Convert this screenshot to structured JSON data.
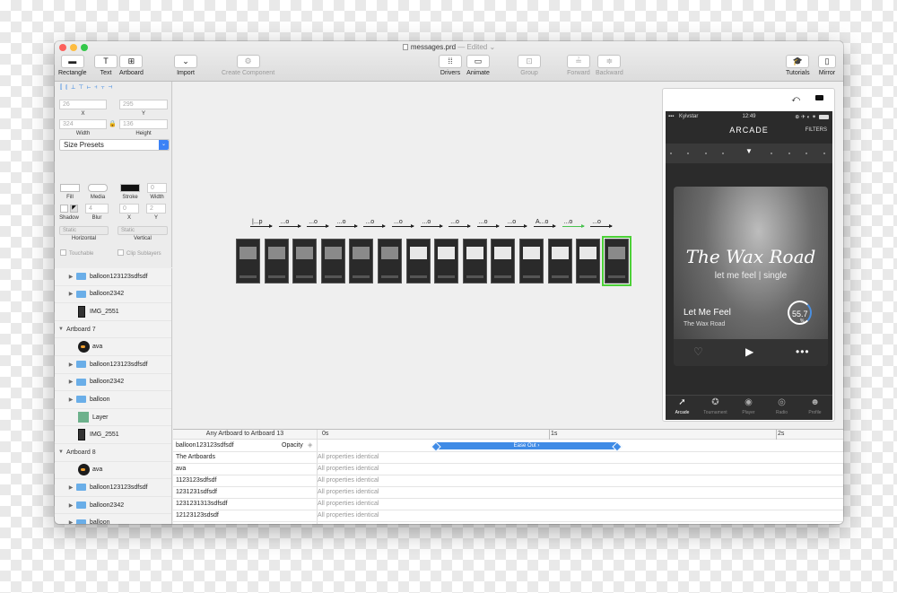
{
  "window": {
    "title": "messages.prd",
    "title_status": "— Edited ⌄",
    "traffic_colors": [
      "#fc605c",
      "#fdbc40",
      "#34c84a"
    ]
  },
  "toolbar": {
    "rectangle": "Rectangle",
    "text": "Text",
    "artboard": "Artboard",
    "import": "Import",
    "create_component": "Create Component",
    "drivers": "Drivers",
    "animate": "Animate",
    "group": "Group",
    "forward": "Forward",
    "backward": "Backward",
    "tutorials": "Tutorials",
    "mirror": "Mirror"
  },
  "inspector": {
    "x_value": "26",
    "y_value": "295",
    "x_label": "X",
    "y_label": "Y",
    "width_value": "324",
    "height_value": "136",
    "width_label": "Width",
    "height_label": "Height",
    "size_presets": "Size Presets",
    "fill_label": "Fill",
    "media_label": "Media",
    "stroke_label": "Stroke",
    "stroke_width_value": "0",
    "stroke_width_label": "Width",
    "shadow_label": "Shadow",
    "blur_value": "4",
    "blur_label": "Blur",
    "sx_value": "0",
    "sy_value": "2",
    "sx_label": "X",
    "sy_label": "Y",
    "horizontal_value": "Static",
    "vertical_value": "Static",
    "horizontal_label": "Horizontal",
    "vertical_label": "Vertical",
    "touchable": "Touchable",
    "clip_sublayers": "Clip Sublayers"
  },
  "layers": [
    {
      "type": "folder",
      "label": "balloon123123sdfsdf",
      "indent": 1
    },
    {
      "type": "folder",
      "label": "balloon2342",
      "indent": 1
    },
    {
      "type": "image",
      "label": "IMG_2551",
      "indent": 1
    },
    {
      "type": "header",
      "label": "Artboard 7"
    },
    {
      "type": "avatar",
      "label": "ava",
      "indent": 1
    },
    {
      "type": "folder",
      "label": "balloon123123sdfsdf",
      "indent": 1
    },
    {
      "type": "folder",
      "label": "balloon2342",
      "indent": 1
    },
    {
      "type": "folder",
      "label": "balloon",
      "indent": 1
    },
    {
      "type": "layer",
      "label": "Layer",
      "indent": 1
    },
    {
      "type": "image",
      "label": "IMG_2551",
      "indent": 1
    },
    {
      "type": "header",
      "label": "Artboard 8"
    },
    {
      "type": "avatar",
      "label": "ava",
      "indent": 1
    },
    {
      "type": "folder",
      "label": "balloon123123sdfsdf",
      "indent": 1
    },
    {
      "type": "folder",
      "label": "balloon2342",
      "indent": 1
    },
    {
      "type": "folder",
      "label": "balloon",
      "indent": 1
    }
  ],
  "canvas": {
    "transition_labels": [
      "|...p",
      "...o",
      "...o",
      "...o",
      "...o",
      "...o",
      "...o",
      "...o",
      "...o",
      "...o",
      "A...o",
      "...o",
      "...o"
    ],
    "artboard_count": 14
  },
  "phone": {
    "carrier": "Kyivstar",
    "time": "12:49",
    "nav_title": "ARCADE",
    "filters": "FILTERS",
    "art_title": "The Wax Road",
    "art_subtitle": "let me feel | single",
    "song": "Let Me Feel",
    "artist": "The Wax Road",
    "gauge_value": "55.7",
    "gauge_unit": "%",
    "tabs": [
      "Arcade",
      "Tournament",
      "Player",
      "Radio",
      "Profile"
    ]
  },
  "timeline": {
    "header": "Any Artboard to Artboard 13",
    "ticks": [
      "0s",
      "1s",
      "2s"
    ],
    "first_row": "balloon123123sdfsdf",
    "property": "Opacity",
    "ease_label": "Ease Out ›",
    "rows": [
      "The Artboards",
      "ava",
      "1123123sdfsdf",
      "1231231sdfsdf",
      "1231231313sdfsdf",
      "12123123sdsdf"
    ],
    "identical": "All properties identical"
  }
}
